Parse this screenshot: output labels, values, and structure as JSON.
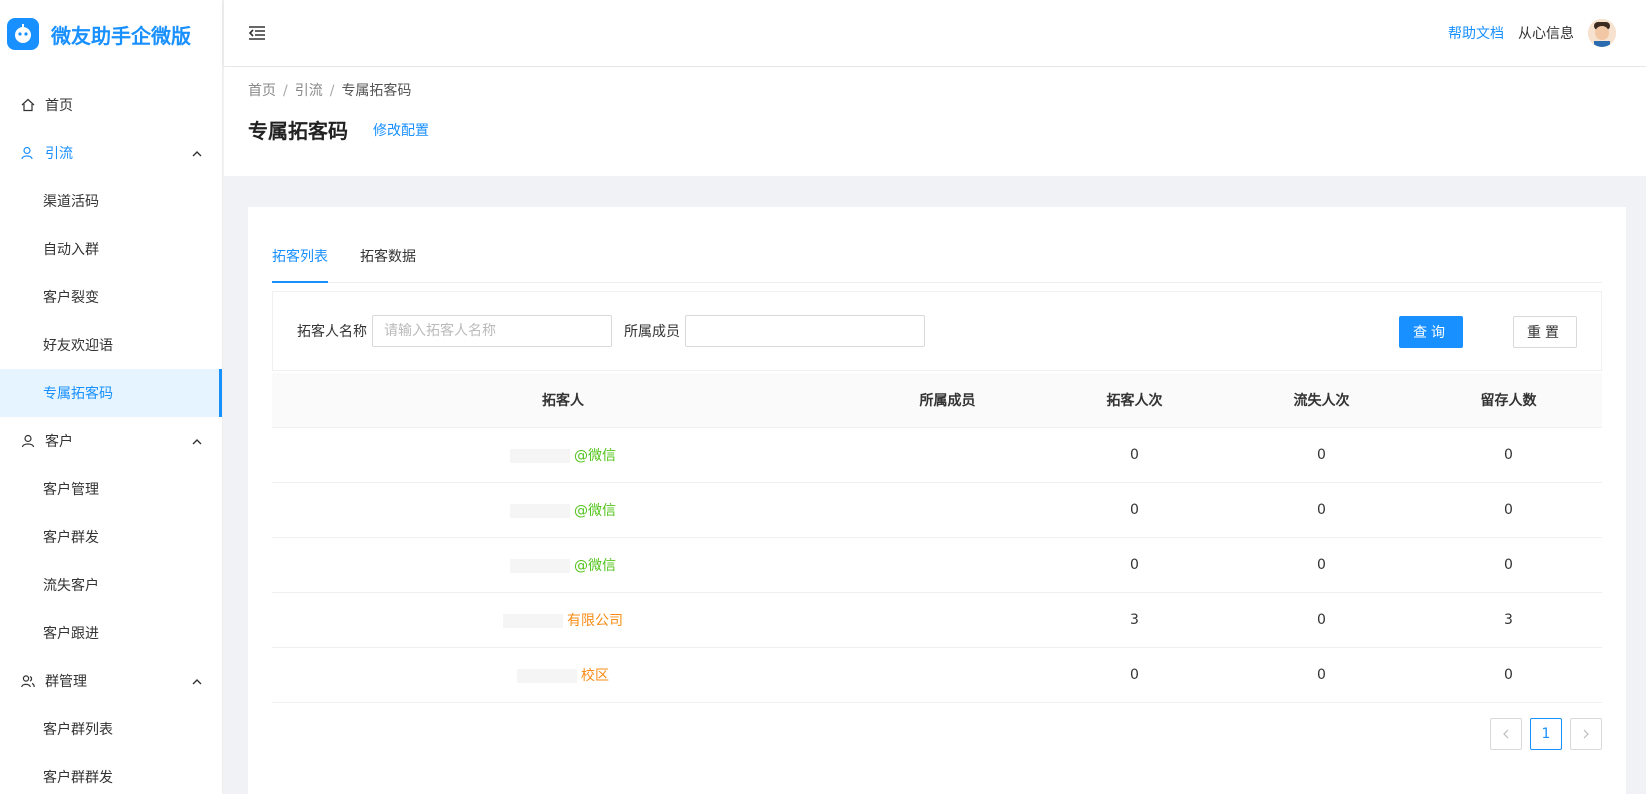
{
  "app": {
    "title": "微友助手企微版"
  },
  "header": {
    "help": "帮助文档",
    "user": "从心信息"
  },
  "sidebar": {
    "home": "首页",
    "groups": [
      {
        "label": "引流",
        "items": [
          "渠道活码",
          "自动入群",
          "客户裂变",
          "好友欢迎语",
          "专属拓客码"
        ]
      },
      {
        "label": "客户",
        "items": [
          "客户管理",
          "客户群发",
          "流失客户",
          "客户跟进"
        ]
      },
      {
        "label": "群管理",
        "items": [
          "客户群列表",
          "客户群群发"
        ]
      }
    ]
  },
  "breadcrumb": {
    "home": "首页",
    "section": "引流",
    "current": "专属拓客码"
  },
  "page": {
    "title": "专属拓客码",
    "edit": "修改配置"
  },
  "tabs": {
    "list": "拓客列表",
    "data": "拓客数据"
  },
  "filter": {
    "name_label": "拓客人名称",
    "name_placeholder": "请输入拓客人名称",
    "member_label": "所属成员",
    "query": "查询",
    "reset": "重置"
  },
  "table": {
    "headers": [
      "拓客人",
      "所属成员",
      "拓客人次",
      "流失人次",
      "留存人数"
    ],
    "rows": [
      {
        "tag": "@微信",
        "tag_type": "wx",
        "member": "",
        "count": "0",
        "lost": "0",
        "kept": "0"
      },
      {
        "tag": "@微信",
        "tag_type": "wx",
        "member": "",
        "count": "0",
        "lost": "0",
        "kept": "0"
      },
      {
        "tag": "@微信",
        "tag_type": "wx",
        "member": "",
        "count": "0",
        "lost": "0",
        "kept": "0"
      },
      {
        "tag": "有限公司",
        "tag_type": "co",
        "member": "",
        "count": "3",
        "lost": "0",
        "kept": "3"
      },
      {
        "tag": "校区",
        "tag_type": "co",
        "member": "",
        "count": "0",
        "lost": "0",
        "kept": "0"
      }
    ]
  },
  "pagination": {
    "current": "1"
  },
  "colors": {
    "primary": "#1890ff",
    "wx": "#52c41a",
    "company": "#fa8c16"
  }
}
